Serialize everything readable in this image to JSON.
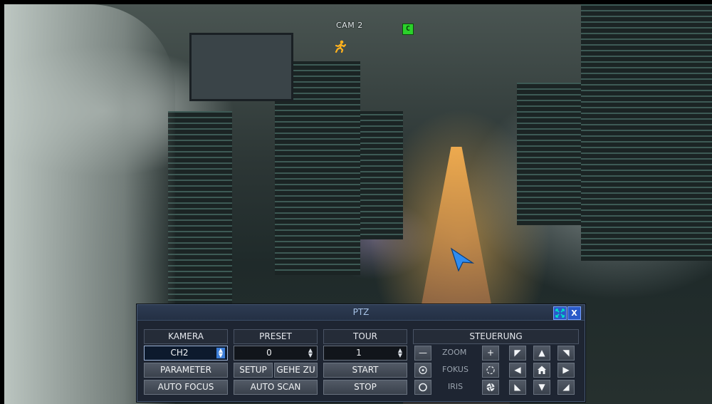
{
  "camera_overlay": {
    "cam_label": "CAM 2",
    "badge": "C",
    "motion_icon": "running-person-icon"
  },
  "ptz": {
    "title": "PTZ",
    "maximize_icon": "maximize-icon",
    "close_label": "X",
    "kamera": {
      "header": "KAMERA",
      "channel_value": "CH2",
      "parameter_label": "PARAMETER",
      "auto_focus_label": "AUTO FOCUS"
    },
    "preset": {
      "header": "PRESET",
      "value": "0",
      "setup_label": "SETUP",
      "gehe_zu_label": "GEHE ZU",
      "auto_scan_label": "AUTO SCAN"
    },
    "tour": {
      "header": "TOUR",
      "value": "1",
      "start_label": "START",
      "stop_label": "STOP"
    },
    "steuerung": {
      "header": "STEUERUNG",
      "zoom_label": "ZOOM",
      "fokus_label": "FOKUS",
      "iris_label": "IRIS",
      "zoom_minus": "—",
      "zoom_plus": "+"
    }
  },
  "colors": {
    "panel_bg": "#1e2532",
    "title_text": "#a8c4e8",
    "selected_spinner": "#3d7fd9",
    "badge_green": "#2bd22b",
    "motion_orange": "#ffb21e"
  }
}
